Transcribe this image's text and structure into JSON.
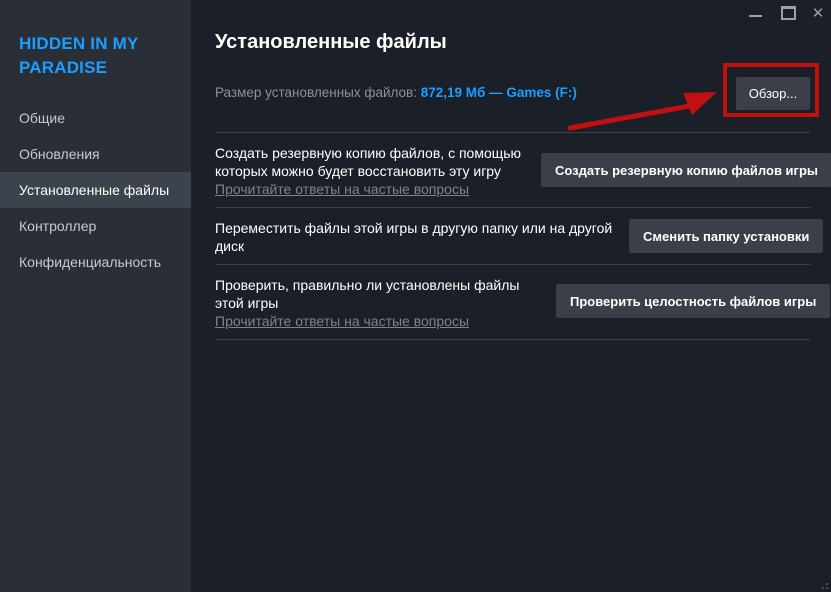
{
  "window": {
    "minimize_icon": "minimize-icon",
    "maximize_icon": "maximize-icon",
    "close_icon": "close-icon",
    "close_glyph": "✕"
  },
  "sidebar": {
    "game_title": "HIDDEN IN MY PARADISE",
    "items": [
      {
        "label": "Общие",
        "active": false
      },
      {
        "label": "Обновления",
        "active": false
      },
      {
        "label": "Установленные файлы",
        "active": true
      },
      {
        "label": "Контроллер",
        "active": false
      },
      {
        "label": "Конфиденциальность",
        "active": false
      }
    ]
  },
  "main": {
    "title": "Установленные файлы",
    "size_label": "Размер установленных файлов:",
    "size_value": "872,19 Мб — Games (F:)",
    "browse_label": "Обзор...",
    "rows": [
      {
        "text": "Создать резервную копию файлов, с помощью которых можно будет восстановить эту игру",
        "link": "Прочитайте ответы на частые вопросы",
        "button": "Создать резервную копию файлов игры"
      },
      {
        "text": "Переместить файлы этой игры в другую папку или на другой диск",
        "button": "Сменить папку установки"
      },
      {
        "text": "Проверить, правильно ли установлены файлы этой игры",
        "link": "Прочитайте ответы на частые вопросы",
        "button": "Проверить целостность файлов игры"
      }
    ]
  },
  "colors": {
    "background": "#1b1f27",
    "sidebar": "#2a2e36",
    "accent": "#1a9fff",
    "highlight": "#c0100f"
  }
}
